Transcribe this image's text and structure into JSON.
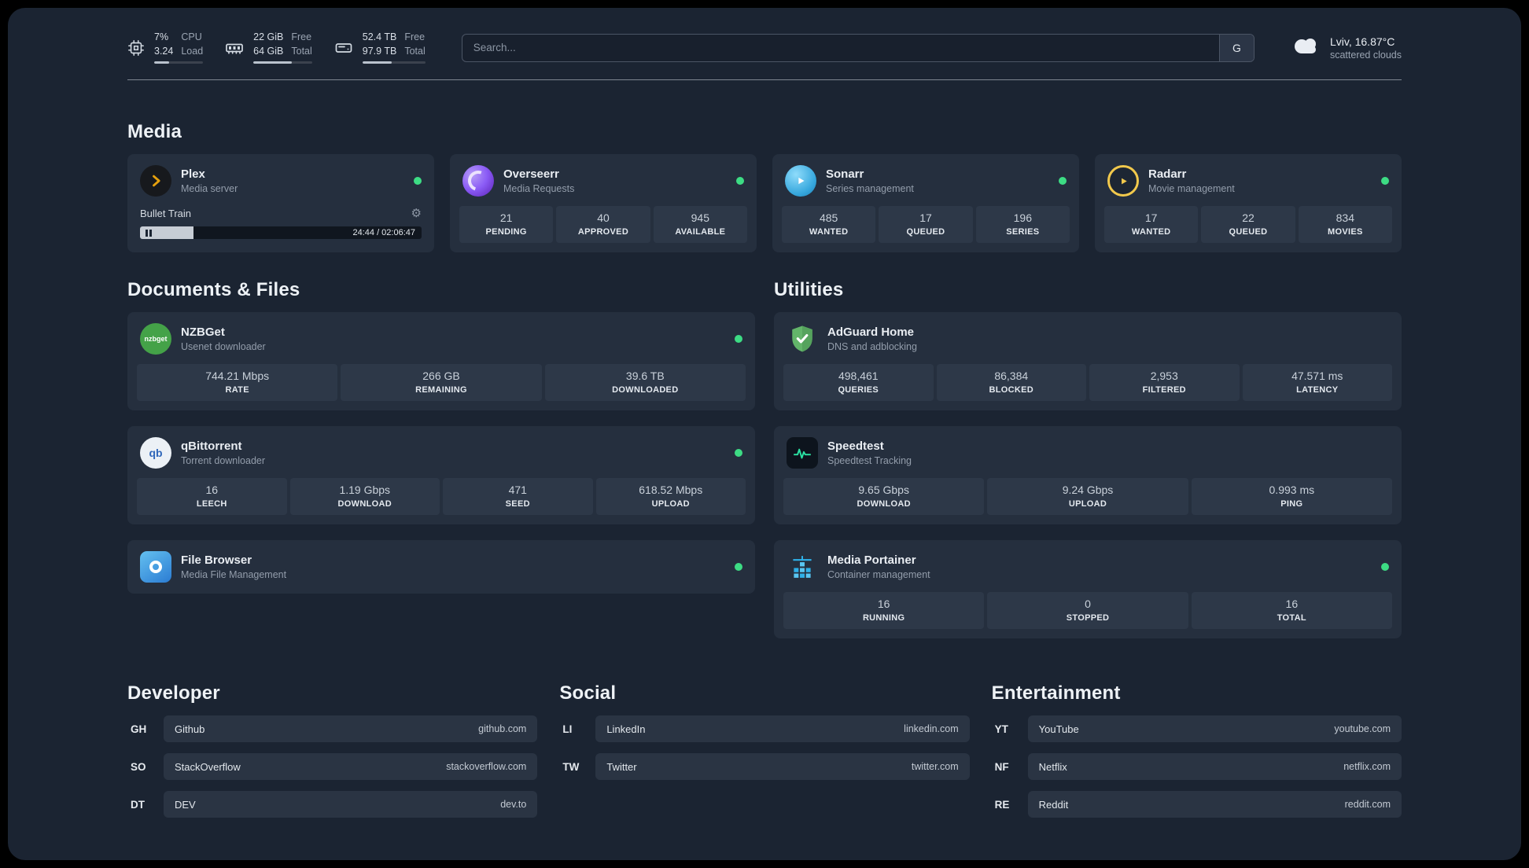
{
  "colors": {
    "status_online": "#3ddc84",
    "accent_plex": "#e5a00d",
    "accent_radarr": "#f2c94c",
    "accent_speedtest": "#2be3a4"
  },
  "icons": {
    "gear": "⚙"
  },
  "topbar": {
    "resources": [
      {
        "icon": "cpu-icon",
        "v1": "7%",
        "v2": "3.24",
        "l1": "CPU",
        "l2": "Load",
        "percent": 30
      },
      {
        "icon": "memory-icon",
        "v1": "22 GiB",
        "v2": "64 GiB",
        "l1": "Free",
        "l2": "Total",
        "percent": 66
      },
      {
        "icon": "disk-icon",
        "v1": "52.4 TB",
        "v2": "97.9 TB",
        "l1": "Free",
        "l2": "Total",
        "percent": 47
      }
    ],
    "search": {
      "placeholder": "Search...",
      "provider_button": "G"
    },
    "weather": {
      "location": "Lviv, 16.87°C",
      "condition": "scattered clouds"
    }
  },
  "sections": {
    "media": "Media",
    "documents": "Documents & Files",
    "utilities": "Utilities",
    "developer": "Developer",
    "social": "Social",
    "entertainment": "Entertainment"
  },
  "services": {
    "plex": {
      "name": "Plex",
      "subtitle": "Media server",
      "player": {
        "track": "Bullet Train",
        "time": "24:44 / 02:06:47",
        "progress_percent": 19
      }
    },
    "overseerr": {
      "name": "Overseerr",
      "subtitle": "Media Requests",
      "stats": [
        {
          "value": "21",
          "label": "PENDING"
        },
        {
          "value": "40",
          "label": "APPROVED"
        },
        {
          "value": "945",
          "label": "AVAILABLE"
        }
      ]
    },
    "sonarr": {
      "name": "Sonarr",
      "subtitle": "Series management",
      "stats": [
        {
          "value": "485",
          "label": "WANTED"
        },
        {
          "value": "17",
          "label": "QUEUED"
        },
        {
          "value": "196",
          "label": "SERIES"
        }
      ]
    },
    "radarr": {
      "name": "Radarr",
      "subtitle": "Movie management",
      "stats": [
        {
          "value": "17",
          "label": "WANTED"
        },
        {
          "value": "22",
          "label": "QUEUED"
        },
        {
          "value": "834",
          "label": "MOVIES"
        }
      ]
    },
    "nzbget": {
      "name": "NZBGet",
      "subtitle": "Usenet downloader",
      "icon_text": "nzbget",
      "stats": [
        {
          "value": "744.21 Mbps",
          "label": "RATE"
        },
        {
          "value": "266 GB",
          "label": "REMAINING"
        },
        {
          "value": "39.6 TB",
          "label": "DOWNLOADED"
        }
      ]
    },
    "qbittorrent": {
      "name": "qBittorrent",
      "subtitle": "Torrent downloader",
      "icon_text": "qb",
      "stats": [
        {
          "value": "16",
          "label": "LEECH"
        },
        {
          "value": "1.19 Gbps",
          "label": "DOWNLOAD"
        },
        {
          "value": "471",
          "label": "SEED"
        },
        {
          "value": "618.52 Mbps",
          "label": "UPLOAD"
        }
      ]
    },
    "filebrowser": {
      "name": "File Browser",
      "subtitle": "Media File Management"
    },
    "adguard": {
      "name": "AdGuard Home",
      "subtitle": "DNS and adblocking",
      "stats": [
        {
          "value": "498,461",
          "label": "QUERIES"
        },
        {
          "value": "86,384",
          "label": "BLOCKED"
        },
        {
          "value": "2,953",
          "label": "FILTERED"
        },
        {
          "value": "47.571 ms",
          "label": "LATENCY"
        }
      ]
    },
    "speedtest": {
      "name": "Speedtest",
      "subtitle": "Speedtest Tracking",
      "stats": [
        {
          "value": "9.65 Gbps",
          "label": "DOWNLOAD"
        },
        {
          "value": "9.24 Gbps",
          "label": "UPLOAD"
        },
        {
          "value": "0.993 ms",
          "label": "PING"
        }
      ]
    },
    "portainer": {
      "name": "Media Portainer",
      "subtitle": "Container management",
      "stats": [
        {
          "value": "16",
          "label": "RUNNING"
        },
        {
          "value": "0",
          "label": "STOPPED"
        },
        {
          "value": "16",
          "label": "TOTAL"
        }
      ]
    }
  },
  "bookmarks": {
    "developer": [
      {
        "abbr": "GH",
        "name": "Github",
        "domain": "github.com"
      },
      {
        "abbr": "SO",
        "name": "StackOverflow",
        "domain": "stackoverflow.com"
      },
      {
        "abbr": "DT",
        "name": "DEV",
        "domain": "dev.to"
      }
    ],
    "social": [
      {
        "abbr": "LI",
        "name": "LinkedIn",
        "domain": "linkedin.com"
      },
      {
        "abbr": "TW",
        "name": "Twitter",
        "domain": "twitter.com"
      }
    ],
    "entertainment": [
      {
        "abbr": "YT",
        "name": "YouTube",
        "domain": "youtube.com"
      },
      {
        "abbr": "NF",
        "name": "Netflix",
        "domain": "netflix.com"
      },
      {
        "abbr": "RE",
        "name": "Reddit",
        "domain": "reddit.com"
      }
    ]
  }
}
